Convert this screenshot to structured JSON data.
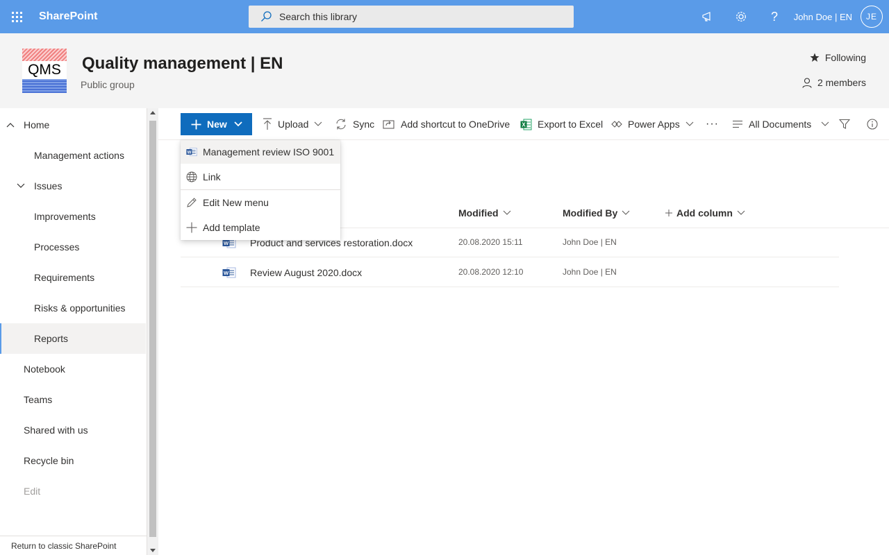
{
  "suite": {
    "brand": "SharePoint",
    "search_placeholder": "Search this library",
    "user_name": "John Doe | EN",
    "avatar_initials": "JE"
  },
  "site": {
    "logo_text": "QMS",
    "title": "Quality management | EN",
    "subtitle": "Public group",
    "following": "Following",
    "members": "2 members"
  },
  "nav": {
    "items": [
      {
        "label": "Home"
      },
      {
        "label": "Management actions"
      },
      {
        "label": "Issues"
      },
      {
        "label": "Improvements"
      },
      {
        "label": "Processes"
      },
      {
        "label": "Requirements"
      },
      {
        "label": "Risks & opportunities"
      },
      {
        "label": "Reports"
      },
      {
        "label": "Notebook"
      },
      {
        "label": "Teams"
      },
      {
        "label": "Shared with us"
      },
      {
        "label": "Recycle bin"
      },
      {
        "label": "Edit"
      }
    ],
    "classic_link": "Return to classic SharePoint"
  },
  "commandbar": {
    "new": "New",
    "upload": "Upload",
    "sync": "Sync",
    "shortcut": "Add shortcut to OneDrive",
    "export": "Export to Excel",
    "powerapps": "Power Apps",
    "more": "···",
    "view": "All Documents"
  },
  "new_menu": {
    "items": [
      {
        "label": "Management review ISO 9001",
        "icon": "word-doc-icon"
      },
      {
        "label": "Link",
        "icon": "globe-icon"
      },
      {
        "label": "Edit New menu",
        "icon": "pencil-icon"
      },
      {
        "label": "Add template",
        "icon": "plus-icon"
      }
    ]
  },
  "list": {
    "columns": {
      "modified": "Modified",
      "modified_by": "Modified By",
      "add_column": "Add column"
    },
    "rows": [
      {
        "name": "Product and services restoration.docx",
        "modified": "20.08.2020 15:11",
        "modified_by": "John Doe | EN"
      },
      {
        "name": "Review August 2020.docx",
        "modified": "20.08.2020 12:10",
        "modified_by": "John Doe | EN"
      }
    ]
  },
  "colors": {
    "suitebar": "#5a9be8",
    "primary_button": "#0f6cbd",
    "header_bg": "#f4f4f4"
  }
}
